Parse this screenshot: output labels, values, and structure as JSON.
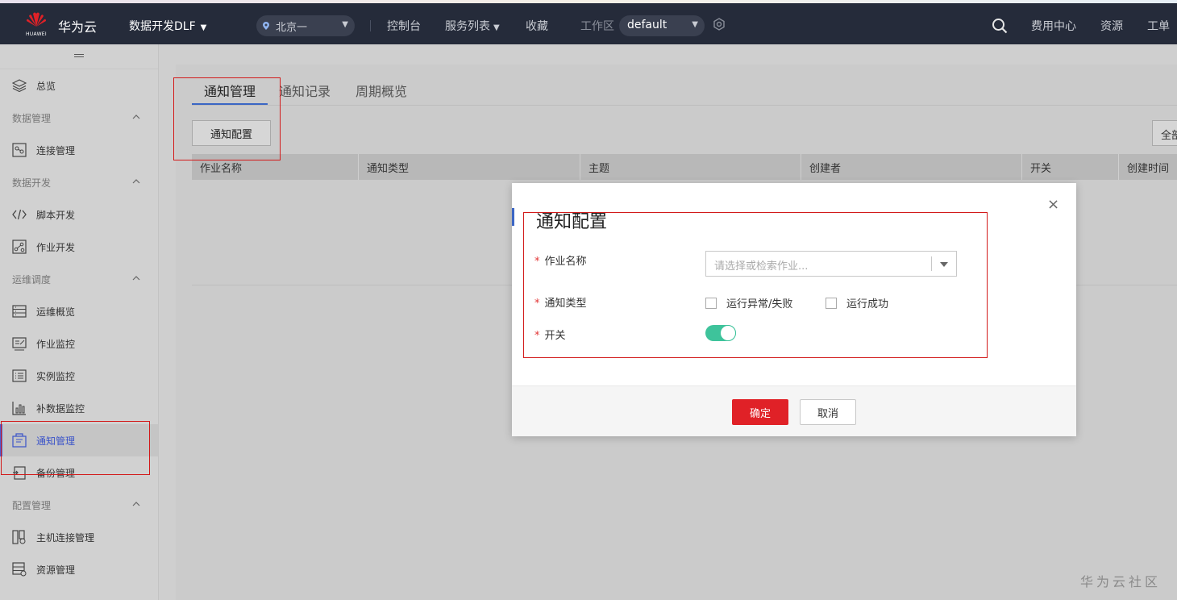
{
  "header": {
    "brand_logo_text": "HUAWEI",
    "brand_name": "华为云",
    "service_name": "数据开发DLF",
    "region": "北京一",
    "nav": {
      "console": "控制台",
      "service_list": "服务列表",
      "favorites": "收藏",
      "workspace_label": "工作区",
      "workspace_value": "default",
      "billing": "费用中心",
      "resources": "资源",
      "tickets": "工单"
    }
  },
  "sidebar": {
    "overview": "总览",
    "groups": {
      "data_management": "数据管理",
      "data_dev": "数据开发",
      "ops": "运维调度",
      "config": "配置管理"
    },
    "items": {
      "connection_mgmt": "连接管理",
      "script_dev": "脚本开发",
      "job_dev": "作业开发",
      "ops_overview": "运维概览",
      "job_monitor": "作业监控",
      "instance_monitor": "实例监控",
      "backfill_monitor": "补数据监控",
      "notify_mgmt": "通知管理",
      "backup_mgmt": "备份管理",
      "host_conn_mgmt": "主机连接管理",
      "resource_mgmt": "资源管理"
    }
  },
  "main": {
    "tabs": [
      "通知管理",
      "通知记录",
      "周期概览"
    ],
    "config_button": "通知配置",
    "all_button": "全部",
    "table_headers": [
      "作业名称",
      "通知类型",
      "主题",
      "创建者",
      "开关",
      "创建时间"
    ]
  },
  "dialog": {
    "title": "通知配置",
    "required_mark": "*",
    "job_name_label": "作业名称",
    "job_name_placeholder": "请选择或检索作业...",
    "notify_type_label": "通知类型",
    "notify_options": [
      "运行异常/失败",
      "运行成功"
    ],
    "switch_label": "开关",
    "switch_on": true,
    "ok": "确定",
    "cancel": "取消",
    "close": "×"
  },
  "watermark": "华为云社区",
  "colors": {
    "topbar": "#252b3a",
    "primary_red": "#e02127",
    "toggle_on": "#3ec39b",
    "accent_blue": "#3b66c4",
    "annotation_red": "#d21a1a"
  }
}
